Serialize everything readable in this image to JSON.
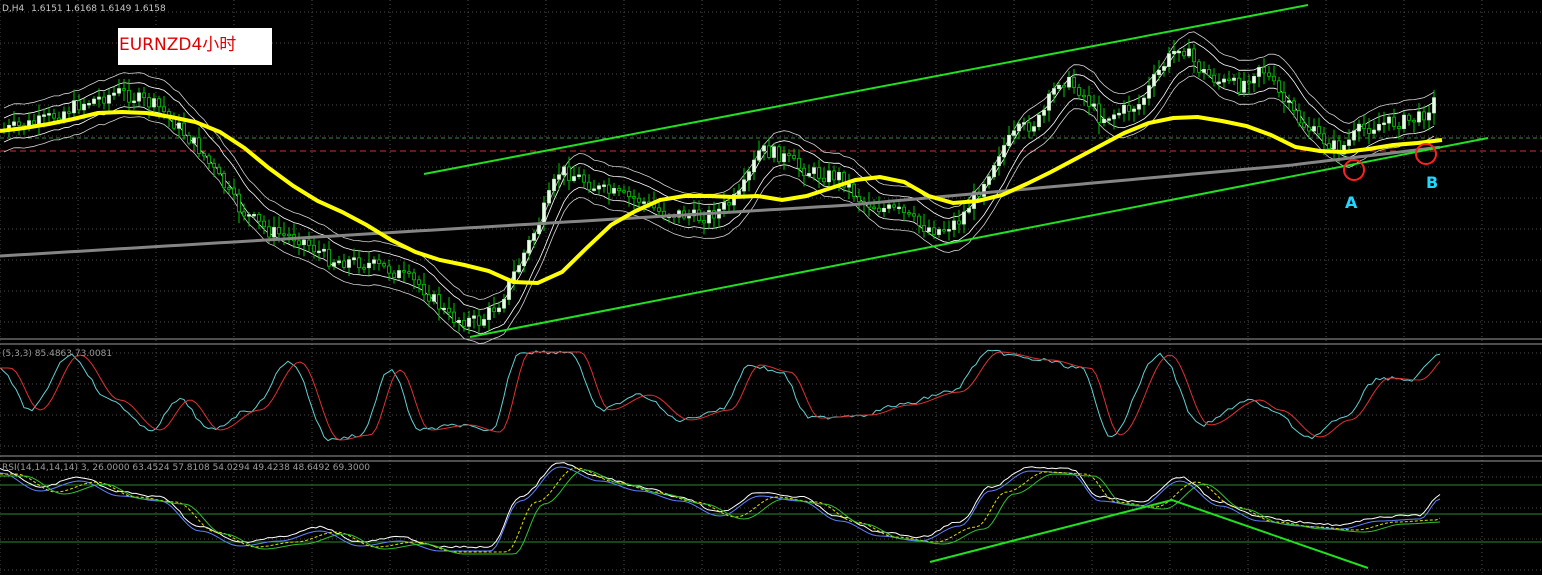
{
  "header": {
    "symbol_short": "D,H4",
    "price_readout": "1.6151 1.6168 1.6149 1.6158"
  },
  "title_label": "EURNZD4小时",
  "annotations": {
    "point_a": "A",
    "point_b": "B"
  },
  "stoch_panel": {
    "readout": "(5,3,3) 85.4863 73.0081"
  },
  "rsi_panel": {
    "readout": "RSI(14,14,14,14) 3, 26.0000 63.4524 57.8108 54.0294 49.4238 48.6492 69.3000"
  },
  "colors": {
    "background": "#000000",
    "grid": "#7a7a7a",
    "bull_candle": "#d8ffd8",
    "candle_wick": "#00c800",
    "ema_fast": "#ffff00",
    "bollinger": "#ffffff",
    "ma_slow": "#808080",
    "channel": "#20e020",
    "hline": "#d03030",
    "marker_circle": "#ff2020",
    "label_ab": "#20d8ff",
    "title_text": "#e00000",
    "stoch_main": "#60d0d0",
    "stoch_signal": "#e03030",
    "osc_white": "#ffffff",
    "osc_blue": "#6080ff",
    "osc_yellow": "#e0e000",
    "osc_green": "#30c030"
  },
  "chart_data": [
    {
      "type": "line",
      "panel": "price",
      "series": [
        {
          "values": [
            131,
            128,
            124,
            119,
            113,
            112,
            113,
            117,
            122,
            132,
            148,
            168,
            186,
            201,
            212,
            225,
            240,
            252,
            260,
            265,
            271,
            282,
            283,
            272,
            248,
            225,
            211,
            200,
            196,
            196,
            197,
            196,
            200,
            196,
            188,
            180,
            177,
            182,
            196,
            203,
            201,
            195,
            184,
            172,
            159,
            146,
            133,
            123,
            118,
            117,
            121,
            126,
            135,
            147,
            151,
            152,
            149,
            145,
            143,
            140
          ]
        }
      ],
      "x_points": 60
    }
  ]
}
